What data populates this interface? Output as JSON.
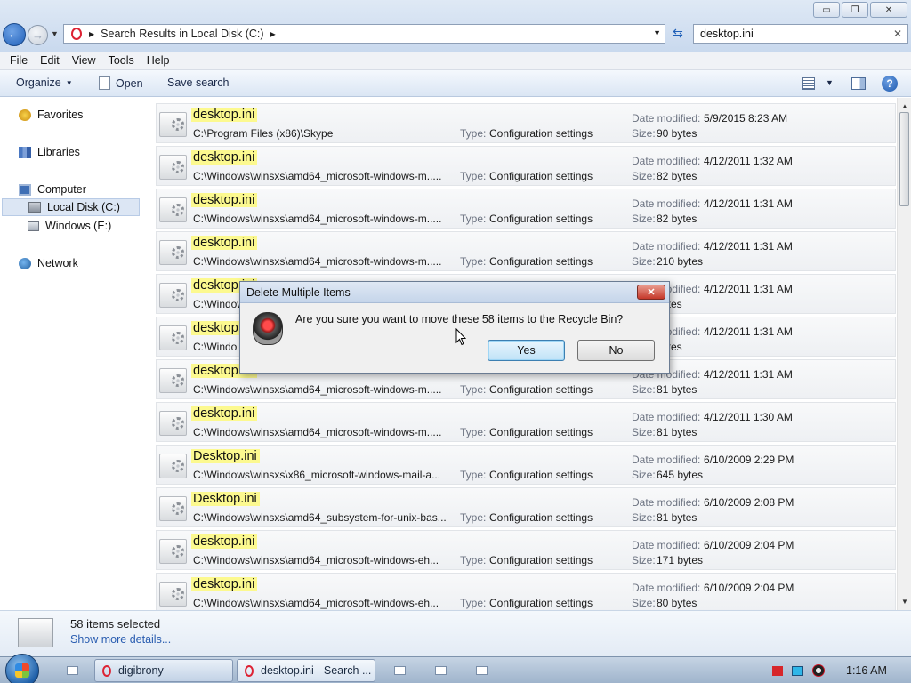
{
  "window": {
    "address_path": "Search Results in Local Disk (C:)",
    "search_value": "desktop.ini",
    "minimize_glyph": "▭",
    "maximize_glyph": "❐",
    "close_glyph": "✕"
  },
  "menu": [
    "File",
    "Edit",
    "View",
    "Tools",
    "Help"
  ],
  "toolbar": {
    "organize": "Organize",
    "open": "Open",
    "save_search": "Save search",
    "help": "?"
  },
  "nav": {
    "favorites": "Favorites",
    "libraries": "Libraries",
    "computer": "Computer",
    "local_disk": "Local Disk (C:)",
    "windows_e": "Windows (E:)",
    "network": "Network"
  },
  "results": {
    "type_label": "Type:",
    "date_label": "Date modified:",
    "size_label": "Size:",
    "rows": [
      {
        "name": "desktop.ini",
        "path": "C:\\Program Files (x86)\\Skype",
        "type": "Configuration settings",
        "date": "5/9/2015 8:23 AM",
        "size": "90 bytes"
      },
      {
        "name": "desktop.ini",
        "path": "C:\\Windows\\winsxs\\amd64_microsoft-windows-m.....",
        "type": "Configuration settings",
        "date": "4/12/2011 1:32 AM",
        "size": "82 bytes"
      },
      {
        "name": "desktop.ini",
        "path": "C:\\Windows\\winsxs\\amd64_microsoft-windows-m.....",
        "type": "Configuration settings",
        "date": "4/12/2011 1:31 AM",
        "size": "82 bytes"
      },
      {
        "name": "desktop.ini",
        "path": "C:\\Windows\\winsxs\\amd64_microsoft-windows-m.....",
        "type": "Configuration settings",
        "date": "4/12/2011 1:31 AM",
        "size": "210 bytes"
      },
      {
        "name": "desktop.ini",
        "path": "C:\\Windows",
        "type": "",
        "date": "4/12/2011 1:31 AM",
        "size": "bytes"
      },
      {
        "name": "desktop.ini",
        "path": "C:\\Windo",
        "type": "",
        "date": "4/12/2011 1:31 AM",
        "size": "bytes"
      },
      {
        "name": "desktop.ini",
        "path": "C:\\Windows\\winsxs\\amd64_microsoft-windows-m.....",
        "type": "Configuration settings",
        "date": "4/12/2011 1:31 AM",
        "size": "81 bytes"
      },
      {
        "name": "desktop.ini",
        "path": "C:\\Windows\\winsxs\\amd64_microsoft-windows-m.....",
        "type": "Configuration settings",
        "date": "4/12/2011 1:30 AM",
        "size": "81 bytes"
      },
      {
        "name": "Desktop.ini",
        "path": "C:\\Windows\\winsxs\\x86_microsoft-windows-mail-a...",
        "type": "Configuration settings",
        "date": "6/10/2009 2:29 PM",
        "size": "645 bytes"
      },
      {
        "name": "Desktop.ini",
        "path": "C:\\Windows\\winsxs\\amd64_subsystem-for-unix-bas...",
        "type": "Configuration settings",
        "date": "6/10/2009 2:08 PM",
        "size": "81 bytes"
      },
      {
        "name": "desktop.ini",
        "path": "C:\\Windows\\winsxs\\amd64_microsoft-windows-eh...",
        "type": "Configuration settings",
        "date": "6/10/2009 2:04 PM",
        "size": "171 bytes"
      },
      {
        "name": "desktop.ini",
        "path": "C:\\Windows\\winsxs\\amd64_microsoft-windows-eh...",
        "type": "Configuration settings",
        "date": "6/10/2009 2:04 PM",
        "size": "80 bytes"
      }
    ]
  },
  "details": {
    "selected": "58 items selected",
    "more": "Show more details..."
  },
  "dialog": {
    "title": "Delete Multiple Items",
    "message": "Are you sure you want to move these 58 items to the Recycle Bin?",
    "yes": "Yes",
    "no": "No",
    "close": "✕"
  },
  "taskbar": {
    "task1": "digibrony",
    "task2": "desktop.ini - Search ...",
    "time": "1:16 AM"
  }
}
